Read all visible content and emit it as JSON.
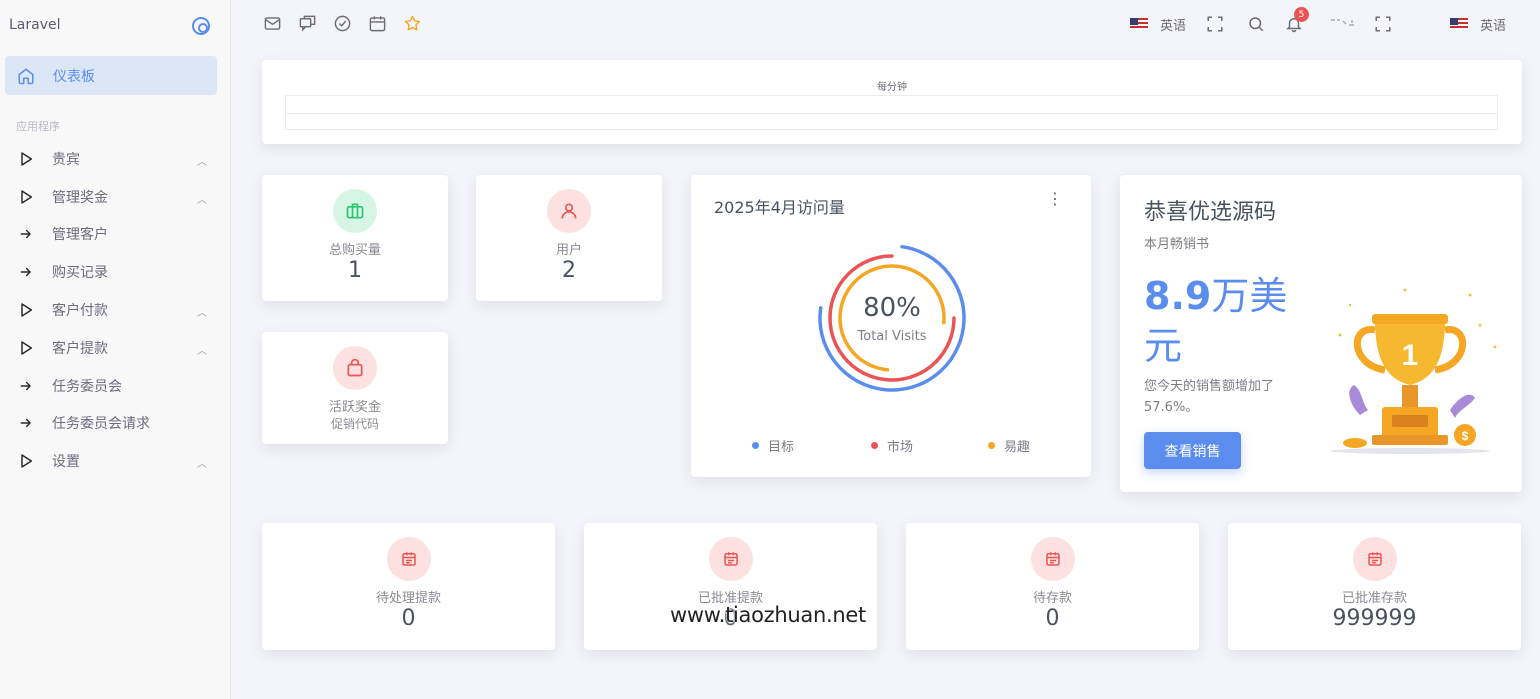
{
  "sidebar": {
    "brand": "Laravel",
    "active": "仪表板",
    "section": "应用程序",
    "items": [
      {
        "label": "贵宾",
        "kind": "group"
      },
      {
        "label": "管理奖金",
        "kind": "group"
      },
      {
        "label": "管理客户",
        "kind": "link"
      },
      {
        "label": "购买记录",
        "kind": "link"
      },
      {
        "label": "客户付款",
        "kind": "group"
      },
      {
        "label": "客户提款",
        "kind": "group"
      },
      {
        "label": "任务委员会",
        "kind": "link"
      },
      {
        "label": "任务委员会请求",
        "kind": "link"
      },
      {
        "label": "设置",
        "kind": "group"
      }
    ]
  },
  "topbar": {
    "icons": [
      "mail-icon",
      "chat-icon",
      "check-circle-icon",
      "calendar-icon",
      "star-icon"
    ],
    "lang1": "英语",
    "lang2": "英语",
    "notification_count": "5"
  },
  "chart_strip": {
    "caption": "每分钟"
  },
  "stats": {
    "purchases": {
      "label": "总购买量",
      "value": "1",
      "color": "#28c76f"
    },
    "users": {
      "label": "用户",
      "value": "2",
      "color": "#ea5455"
    },
    "bonus": {
      "label": "活跃奖金",
      "sub": "促销代码",
      "color": "#ea5455"
    }
  },
  "visits": {
    "title": "2025年4月访问量",
    "center_value": "80%",
    "center_label": "Total Visits",
    "legend": [
      {
        "label": "目标",
        "color": "#5b8def"
      },
      {
        "label": "市场",
        "color": "#ea5455"
      },
      {
        "label": "易趣",
        "color": "#f5a623"
      }
    ]
  },
  "congrats": {
    "title": "恭喜优选源码",
    "subtitle": "本月畅销书",
    "amount_num": "8.9",
    "amount_unit": "万美元",
    "desc": "您今天的销售额增加了57.6%。",
    "button": "查看销售"
  },
  "bottom": [
    {
      "label": "待处理提款",
      "value": "0"
    },
    {
      "label": "已批准提款",
      "value": "0"
    },
    {
      "label": "待存款",
      "value": "0"
    },
    {
      "label": "已批准存款",
      "value": "999999"
    }
  ],
  "watermark": "www.tiaozhuan.net",
  "colors": {
    "accent": "#5b8def",
    "danger": "#ea5455",
    "success": "#28c76f",
    "warning": "#f5a623"
  }
}
